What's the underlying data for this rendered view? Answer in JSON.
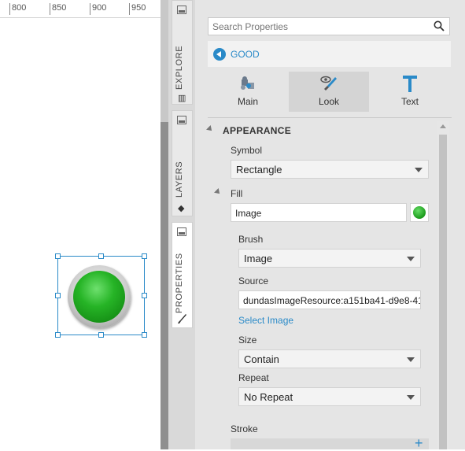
{
  "ruler": {
    "ticks": [
      "800",
      "850",
      "900",
      "950"
    ]
  },
  "side_tabs": {
    "explore": "EXPLORE",
    "layers": "LAYERS",
    "properties": "PROPERTIES"
  },
  "panel": {
    "search_placeholder": "Search Properties",
    "breadcrumb": "GOOD",
    "tabs": {
      "main": "Main",
      "look": "Look",
      "text": "Text"
    },
    "appearance": {
      "title": "APPEARANCE",
      "symbol_label": "Symbol",
      "symbol_value": "Rectangle",
      "fill_label": "Fill",
      "fill_value": "Image",
      "brush_label": "Brush",
      "brush_value": "Image",
      "source_label": "Source",
      "source_value": "dundasImageResource:a151ba41-d9e8-41",
      "select_image": "Select Image",
      "size_label": "Size",
      "size_value": "Contain",
      "repeat_label": "Repeat",
      "repeat_value": "No Repeat",
      "stroke_label": "Stroke"
    },
    "colors": {
      "accent": "#2a8ac8",
      "indicator_green": "#26b426"
    }
  }
}
